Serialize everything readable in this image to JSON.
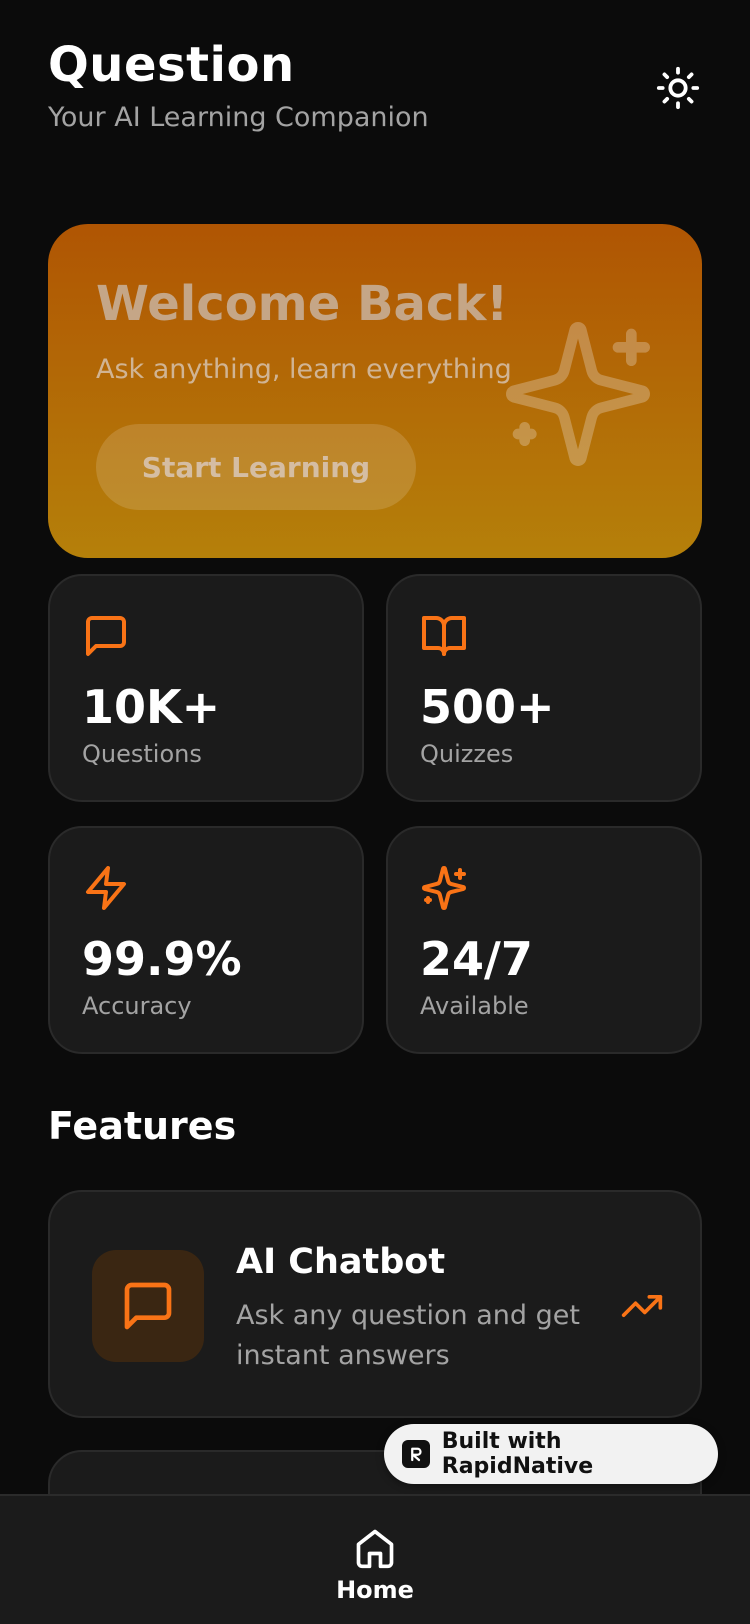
{
  "header": {
    "title": "Question",
    "subtitle": "Your AI Learning Companion",
    "theme_icon": "sun-icon"
  },
  "hero": {
    "title": "Welcome Back!",
    "subtitle": "Ask anything, learn everything",
    "button_label": "Start Learning",
    "decor_icon": "sparkles-icon"
  },
  "stats": [
    {
      "icon": "message-square-icon",
      "value": "10K+",
      "label": "Questions"
    },
    {
      "icon": "book-open-icon",
      "value": "500+",
      "label": "Quizzes"
    },
    {
      "icon": "zap-icon",
      "value": "99.9%",
      "label": "Accuracy"
    },
    {
      "icon": "sparkles-icon",
      "value": "24/7",
      "label": "Available"
    }
  ],
  "features": {
    "title": "Features",
    "items": [
      {
        "icon": "message-square-icon",
        "title": "AI Chatbot",
        "description": "Ask any question and get instant answers",
        "action_icon": "trending-up-icon"
      }
    ]
  },
  "badge": {
    "text": "Built with RapidNative"
  },
  "bottom_nav": {
    "items": [
      {
        "icon": "home-icon",
        "label": "Home"
      }
    ]
  },
  "colors": {
    "accent": "#f97316",
    "background": "#0b0b0b",
    "card": "#1b1b1b"
  }
}
